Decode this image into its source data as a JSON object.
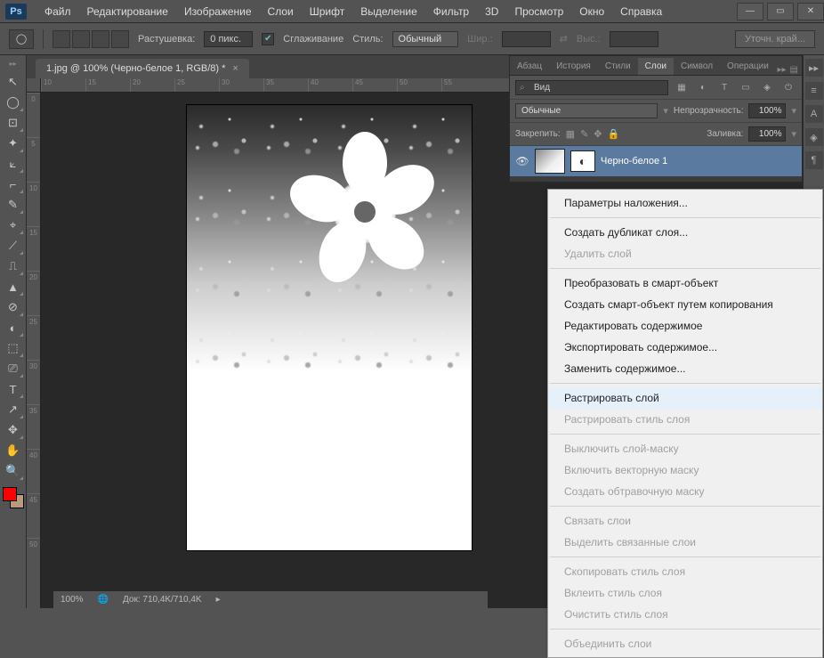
{
  "app": {
    "logo": "Ps"
  },
  "menu": [
    "Файл",
    "Редактирование",
    "Изображение",
    "Слои",
    "Шрифт",
    "Выделение",
    "Фильтр",
    "3D",
    "Просмотр",
    "Окно",
    "Справка"
  ],
  "options": {
    "feather_label": "Растушевка:",
    "feather_value": "0 пикс.",
    "antialias": "Сглаживание",
    "style_label": "Стиль:",
    "style_value": "Обычный",
    "width_label": "Шир.:",
    "height_label": "Выс.:",
    "refine": "Уточн. край..."
  },
  "document": {
    "tab_title": "1.jpg @ 100% (Черно-белое 1, RGB/8) *"
  },
  "ruler_h": [
    "10",
    "15",
    "20",
    "25",
    "30",
    "35",
    "40",
    "45",
    "50",
    "55"
  ],
  "ruler_v": [
    "0",
    "5",
    "10",
    "15",
    "20",
    "25",
    "30",
    "35",
    "40",
    "45",
    "50"
  ],
  "panel": {
    "tabs": [
      "Абзац",
      "История",
      "Стили",
      "Слои",
      "Символ",
      "Операции"
    ],
    "active_tab": "Слои",
    "search_value": "Вид",
    "blend_mode": "Обычные",
    "opacity_label": "Непрозрачность:",
    "opacity_value": "100%",
    "lock_label": "Закрепить:",
    "fill_label": "Заливка:",
    "fill_value": "100%",
    "layer1_name": "Черно-белое 1"
  },
  "context_menu": {
    "items": [
      {
        "label": "Параметры наложения...",
        "enabled": true
      },
      {
        "sep": true
      },
      {
        "label": "Создать дубликат слоя...",
        "enabled": true
      },
      {
        "label": "Удалить слой",
        "enabled": false
      },
      {
        "sep": true
      },
      {
        "label": "Преобразовать в смарт-объект",
        "enabled": true
      },
      {
        "label": "Создать смарт-объект путем копирования",
        "enabled": true
      },
      {
        "label": "Редактировать содержимое",
        "enabled": true
      },
      {
        "label": "Экспортировать содержимое...",
        "enabled": true
      },
      {
        "label": "Заменить содержимое...",
        "enabled": true
      },
      {
        "sep": true
      },
      {
        "label": "Растрировать слой",
        "enabled": true,
        "highlight": true
      },
      {
        "label": "Растрировать стиль слоя",
        "enabled": false
      },
      {
        "sep": true
      },
      {
        "label": "Выключить слой-маску",
        "enabled": false
      },
      {
        "label": "Включить векторную маску",
        "enabled": false
      },
      {
        "label": "Создать обтравочную маску",
        "enabled": false
      },
      {
        "sep": true
      },
      {
        "label": "Связать слои",
        "enabled": false
      },
      {
        "label": "Выделить связанные слои",
        "enabled": false
      },
      {
        "sep": true
      },
      {
        "label": "Скопировать стиль слоя",
        "enabled": false
      },
      {
        "label": "Вклеить стиль слоя",
        "enabled": false
      },
      {
        "label": "Очистить стиль слоя",
        "enabled": false
      },
      {
        "sep": true
      },
      {
        "label": "Объединить слои",
        "enabled": false
      }
    ]
  },
  "status": {
    "zoom": "100%",
    "doc": "Док: 710,4K/710,4K"
  },
  "tools": [
    "↖",
    "◯",
    "⊡",
    "✦",
    "⟀",
    "⌐",
    "✎",
    "⌖",
    "⟋",
    "⎍",
    "▲",
    "⊘",
    "◐",
    "⬚",
    "⎚",
    "T",
    "↗",
    "✥",
    "✋",
    "🔍"
  ]
}
